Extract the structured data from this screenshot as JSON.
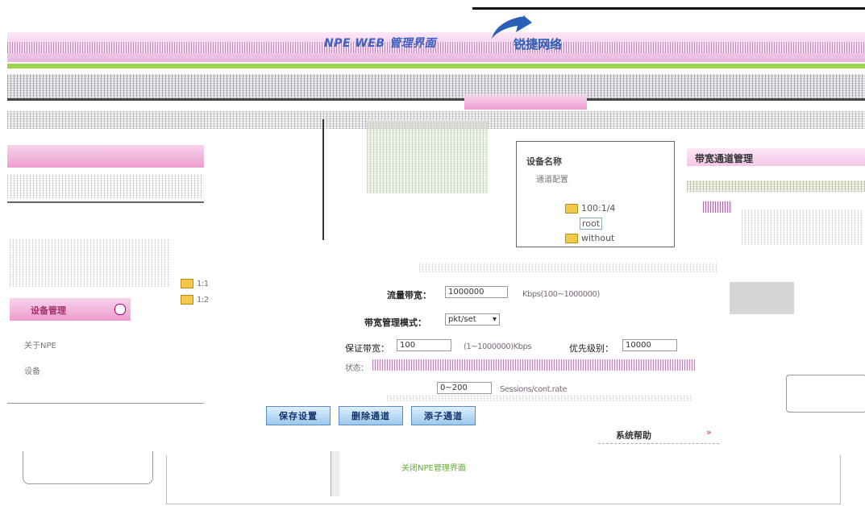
{
  "header": {
    "title": "NPE WEB 管理界面",
    "brand": "锐捷网络"
  },
  "sidebar": {
    "section": "设备管理",
    "item1": "关于NPE",
    "item2": "设备"
  },
  "tree": {
    "root": "设备名称",
    "child_label": "通道配置",
    "nodes": [
      "100:1/4",
      "root",
      "without"
    ]
  },
  "panel": {
    "title": "带宽通道管理",
    "flow_label": "流量带宽：",
    "flow_value": "1000000",
    "flow_hint": "Kbps(100~1000000)",
    "mode_label": "带宽管理模式：",
    "mode_value": "pkt/set",
    "limit_label": "保证带宽：",
    "limit_value": "100",
    "limit_hint": "(1~1000000)Kbps",
    "priority_label": "优先级别：",
    "priority_value": "10000",
    "status_label": "状态：",
    "range_value": "0~200",
    "range_hint": "Sessions/cont.rate"
  },
  "buttons": {
    "save": "保存设置",
    "delete": "删除通道",
    "child": "添子通道"
  },
  "help": {
    "label": "系统帮助"
  },
  "footer": {
    "text": "关闭NPE管理界面"
  },
  "colors": {
    "pink": "#ee9ed0",
    "green": "#9bd24e",
    "blue_btn": "#9cc7ea",
    "header_title": "#3b61c2"
  }
}
